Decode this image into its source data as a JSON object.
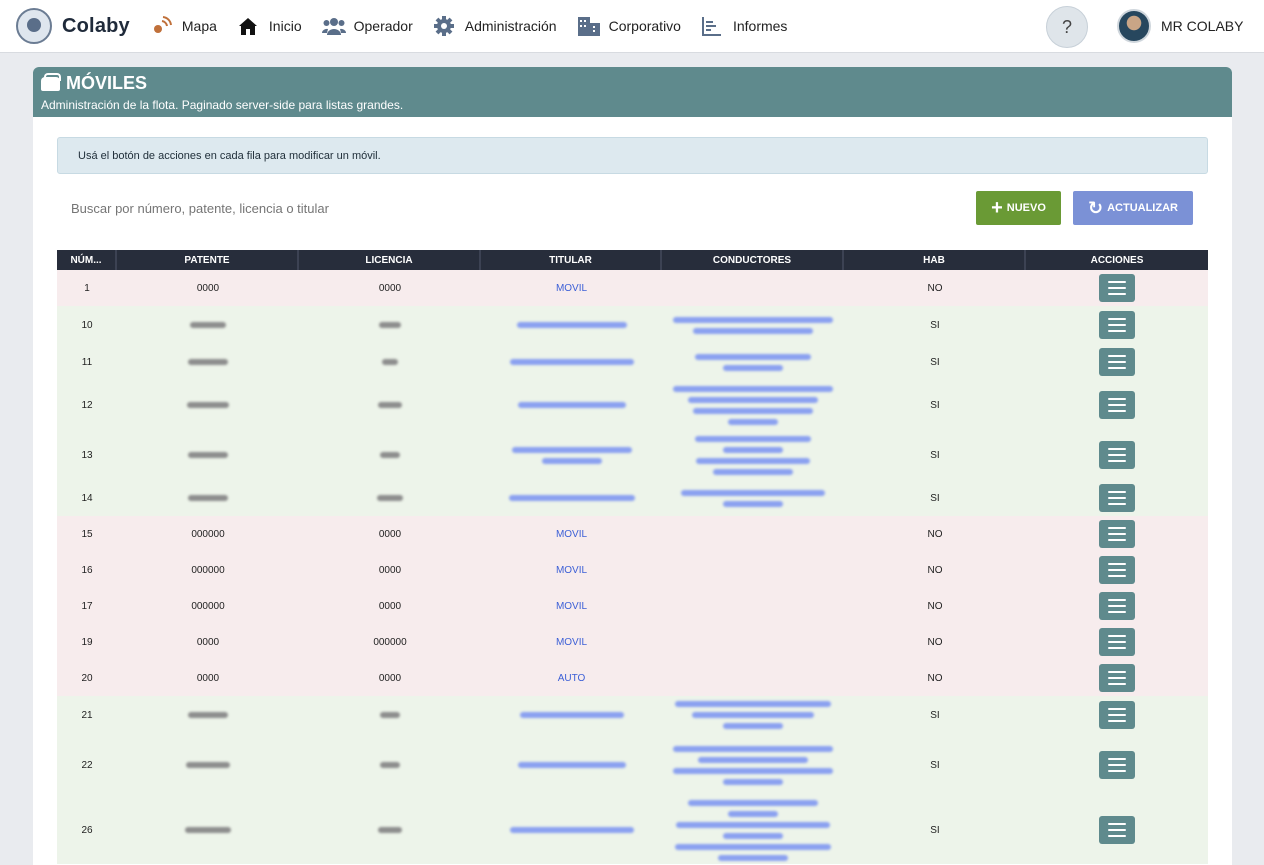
{
  "brand": {
    "name": "Colaby"
  },
  "nav": [
    {
      "label": "Mapa",
      "icon": "satellite-icon"
    },
    {
      "label": "Inicio",
      "icon": "home-icon"
    },
    {
      "label": "Operador",
      "icon": "users-icon"
    },
    {
      "label": "Administración",
      "icon": "gear-icon"
    },
    {
      "label": "Corporativo",
      "icon": "building-icon"
    },
    {
      "label": "Informes",
      "icon": "chart-icon"
    }
  ],
  "help_label": "?",
  "user": {
    "name": "MR COLABY"
  },
  "panel": {
    "title": "MÓVILES",
    "subtitle": "Administración de la flota. Paginado server-side para listas grandes."
  },
  "info_text": "Usá el botón de acciones en cada fila para modificar un móvil.",
  "search": {
    "placeholder": "Buscar por número, patente, licencia o titular"
  },
  "buttons": {
    "new_label": "NUEVO",
    "refresh_label": "ACTUALIZAR"
  },
  "colors": {
    "header": "#5f8a8d",
    "new": "#6a9a35",
    "refresh": "#7b91d6",
    "table_head": "#272d3b",
    "row_no": "#f7eced",
    "row_si": "#edf4ea",
    "titular": "#3c5fd6"
  },
  "table": {
    "columns": [
      "NÚM...",
      "PATENTE",
      "LICENCIA",
      "TITULAR",
      "CONDUCTORES",
      "HAB",
      "ACCIONES"
    ],
    "rows": [
      {
        "num": "1",
        "patente": "0000",
        "licencia": "0000",
        "titular": "MOVIL",
        "conductores": "",
        "hab": "NO"
      },
      {
        "num": "10",
        "patente": "",
        "licencia": "",
        "titular": "",
        "conductores": "",
        "hab": "SI"
      },
      {
        "num": "11",
        "patente": "",
        "licencia": "",
        "titular": "",
        "conductores": "",
        "hab": "SI"
      },
      {
        "num": "12",
        "patente": "",
        "licencia": "",
        "titular": "",
        "conductores": "",
        "hab": "SI"
      },
      {
        "num": "13",
        "patente": "",
        "licencia": "",
        "titular": "",
        "conductores": "",
        "hab": "SI"
      },
      {
        "num": "14",
        "patente": "",
        "licencia": "",
        "titular": "",
        "conductores": "",
        "hab": "SI"
      },
      {
        "num": "15",
        "patente": "000000",
        "licencia": "0000",
        "titular": "MOVIL",
        "conductores": "",
        "hab": "NO"
      },
      {
        "num": "16",
        "patente": "000000",
        "licencia": "0000",
        "titular": "MOVIL",
        "conductores": "",
        "hab": "NO"
      },
      {
        "num": "17",
        "patente": "000000",
        "licencia": "0000",
        "titular": "MOVIL",
        "conductores": "",
        "hab": "NO"
      },
      {
        "num": "19",
        "patente": "0000",
        "licencia": "000000",
        "titular": "MOVIL",
        "conductores": "",
        "hab": "NO"
      },
      {
        "num": "20",
        "patente": "0000",
        "licencia": "0000",
        "titular": "AUTO",
        "conductores": "",
        "hab": "NO"
      },
      {
        "num": "21",
        "patente": "",
        "licencia": "",
        "titular": "",
        "conductores": "",
        "hab": "SI"
      },
      {
        "num": "22",
        "patente": "",
        "licencia": "",
        "titular": "",
        "conductores": "",
        "hab": "SI"
      },
      {
        "num": "26",
        "patente": "",
        "licencia": "",
        "titular": "",
        "conductores": "",
        "hab": "SI"
      }
    ]
  }
}
